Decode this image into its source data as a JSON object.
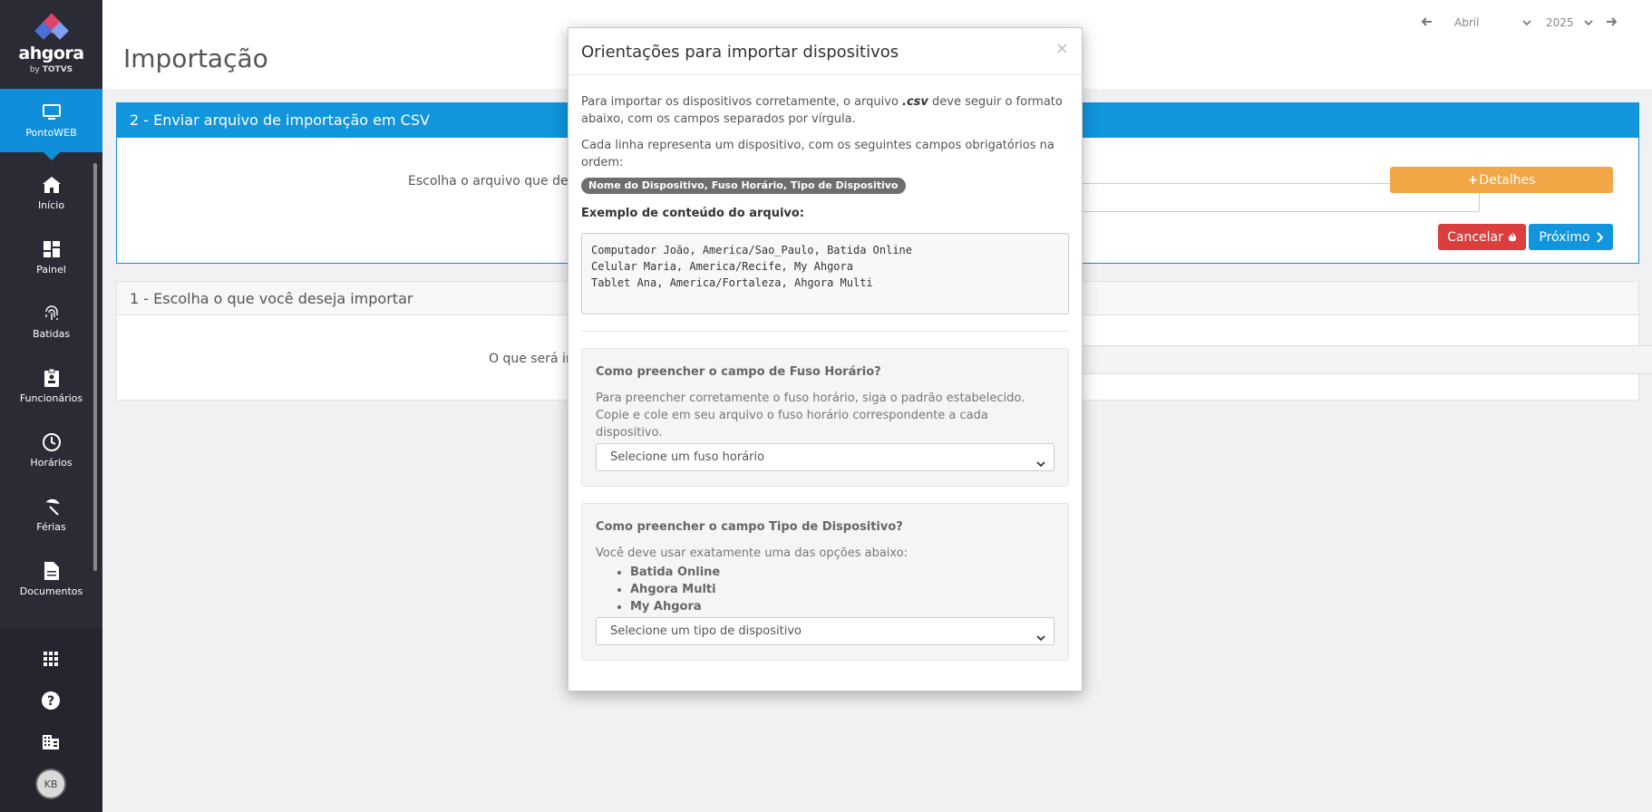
{
  "sidebar": {
    "logo": {
      "name": "ahgora",
      "sub_by": "by",
      "sub_brand": "TOTVS"
    },
    "active_item": {
      "label": "PontoWEB",
      "icon": "monitor-icon"
    },
    "items": [
      {
        "label": "Início",
        "icon": "home-icon"
      },
      {
        "label": "Painel",
        "icon": "dashboard-icon"
      },
      {
        "label": "Batidas",
        "icon": "fingerprint-icon"
      },
      {
        "label": "Funcionários",
        "icon": "badge-icon"
      },
      {
        "label": "Horários",
        "icon": "clock-icon"
      },
      {
        "label": "Férias",
        "icon": "umbrella-icon"
      },
      {
        "label": "Documentos",
        "icon": "document-icon"
      }
    ],
    "bottom_icons": [
      "apps-grid-icon",
      "help-icon",
      "building-icon"
    ],
    "avatar_initials": "KB"
  },
  "header": {
    "title": "Importação",
    "month": "Abril",
    "year": "2025"
  },
  "panel2": {
    "title": "2 - Enviar arquivo de importação em CSV",
    "label": "Escolha o arquivo que dese",
    "details_button": "Detalhes",
    "cancel_button": "Cancelar",
    "next_button": "Próximo"
  },
  "panel1": {
    "title": "1 - Escolha o que você deseja importar",
    "label": "O que será im"
  },
  "modal": {
    "title": "Orientações para importar dispositivos",
    "close": "×",
    "intro_before": "Para importar os dispositivos corretamente, o arquivo ",
    "intro_ext": ".csv",
    "intro_after": " deve seguir o formato abaixo, com os campos separados por vírgula.",
    "fields_intro": "Cada linha representa um dispositivo, com os seguintes campos obrigatórios na ordem:",
    "fields_pill": "Nome do Dispositivo, Fuso Horário, Tipo de Dispositivo",
    "example_title": "Exemplo de conteúdo do arquivo:",
    "example_lines": [
      "Computador João, America/Sao_Paulo, Batida Online",
      "Celular Maria, America/Recife, My Ahgora",
      "Tablet Ana, America/Fortaleza, Ahgora Multi"
    ],
    "timezone_box": {
      "title": "Como preencher o campo de Fuso Horário?",
      "text": "Para preencher corretamente o fuso horário, siga o padrão estabelecido. Copie e cole em seu arquivo o fuso horário correspondente a cada dispositivo.",
      "select_placeholder": "Selecione um fuso horário"
    },
    "device_box": {
      "title": "Como preencher o campo Tipo de Dispositivo?",
      "text": "Você deve usar exatamente uma das opções abaixo:",
      "options": [
        "Batida Online",
        "Ahgora Multi",
        "My Ahgora"
      ],
      "select_placeholder": "Selecione um tipo de dispositivo"
    }
  }
}
